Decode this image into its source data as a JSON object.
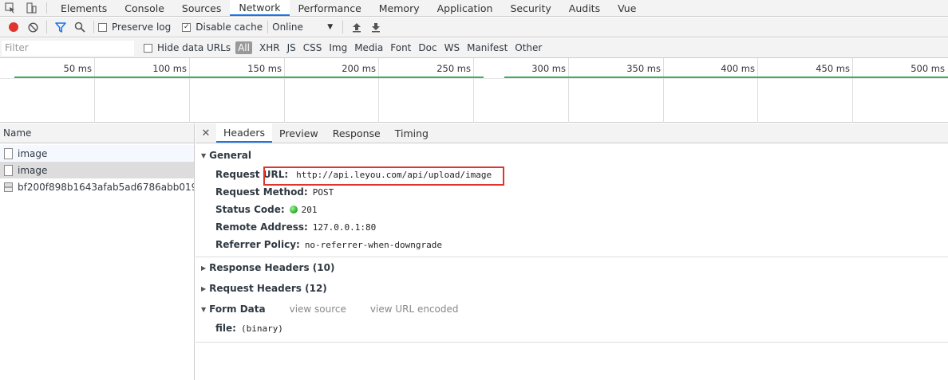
{
  "tabbar": {
    "tabs": [
      "Elements",
      "Console",
      "Sources",
      "Network",
      "Performance",
      "Memory",
      "Application",
      "Security",
      "Audits",
      "Vue"
    ],
    "active": "Network"
  },
  "toolbar": {
    "preserve_log": "Preserve log",
    "disable_cache": "Disable cache",
    "throttle": "Online",
    "record_color": "#e0342f",
    "filter_color": "#1a73e8"
  },
  "filterbar": {
    "placeholder": "Filter",
    "hide_data_urls": "Hide data URLs",
    "types": [
      "All",
      "XHR",
      "JS",
      "CSS",
      "Img",
      "Media",
      "Font",
      "Doc",
      "WS",
      "Manifest",
      "Other"
    ]
  },
  "timeline": {
    "ticks": [
      "50 ms",
      "100 ms",
      "150 ms",
      "200 ms",
      "250 ms",
      "300 ms",
      "350 ms",
      "400 ms",
      "450 ms",
      "500 ms"
    ]
  },
  "reqlist": {
    "header": "Name",
    "rows": [
      "image",
      "image",
      "bf200f898b1643afab5ad6786abb019b.j..."
    ]
  },
  "details": {
    "tabs": [
      "Headers",
      "Preview",
      "Response",
      "Timing"
    ],
    "active_tab": "Headers",
    "general": {
      "title": "General",
      "request_url_label": "Request URL:",
      "request_url": "http://api.leyou.com/api/upload/image",
      "request_method_label": "Request Method:",
      "request_method": "POST",
      "status_code_label": "Status Code:",
      "status_code": "201",
      "remote_address_label": "Remote Address:",
      "remote_address": "127.0.0.1:80",
      "referrer_policy_label": "Referrer Policy:",
      "referrer_policy": "no-referrer-when-downgrade"
    },
    "response_headers": "Response Headers (10)",
    "request_headers": "Request Headers (12)",
    "form_data": {
      "title": "Form Data",
      "view_source": "view source",
      "view_url_encoded": "view URL encoded",
      "file_label": "file:",
      "file_value": "(binary)"
    },
    "status_color": "#21a91d",
    "highlight_color": "#e0342f"
  }
}
